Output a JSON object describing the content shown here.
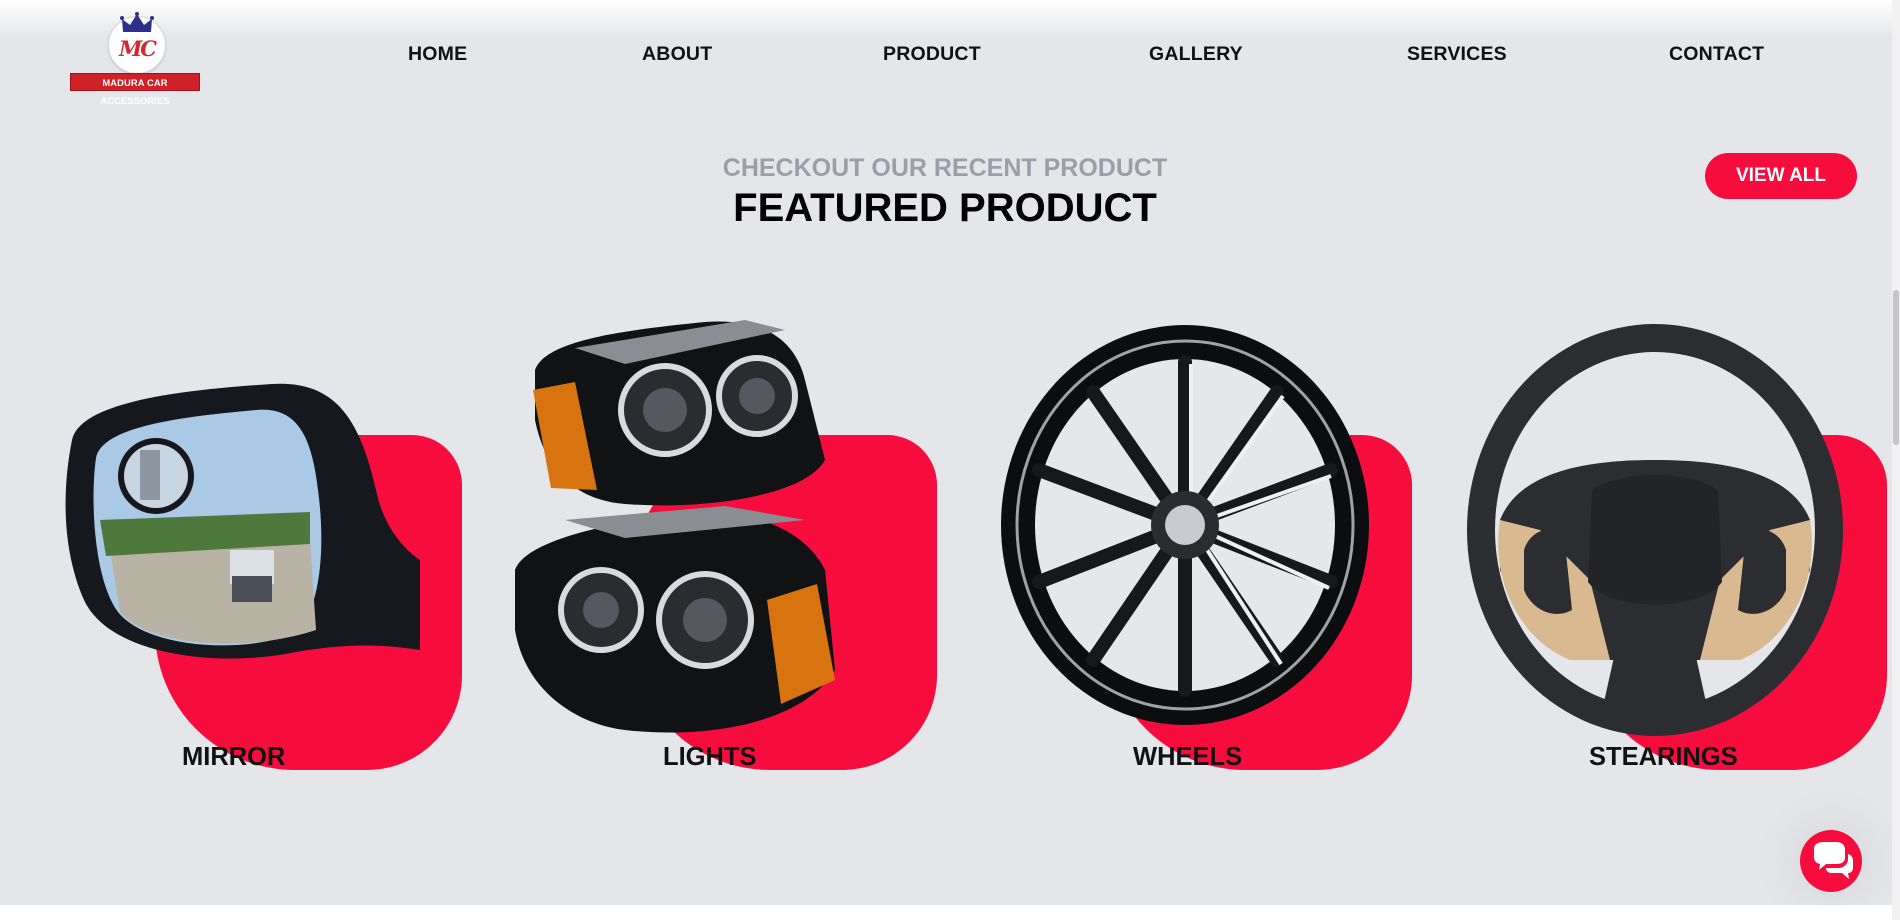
{
  "brand": {
    "monogram": "MC",
    "name": "MADURA CAR ACCESSORIES"
  },
  "nav": {
    "items": [
      {
        "label": "HOME"
      },
      {
        "label": "ABOUT"
      },
      {
        "label": "PRODUCT"
      },
      {
        "label": "GALLERY"
      },
      {
        "label": "SERVICES"
      },
      {
        "label": "CONTACT"
      }
    ]
  },
  "featured": {
    "subtitle": "CHECKOUT OUR RECENT PRODUCT",
    "title": "FEATURED PRODUCT",
    "view_all_label": "VIEW ALL",
    "products": [
      {
        "label": "MIRROR",
        "icon": "mirror-icon"
      },
      {
        "label": "LIGHTS",
        "icon": "headlight-icon"
      },
      {
        "label": "WHEELS",
        "icon": "wheel-icon"
      },
      {
        "label": "STEARINGS",
        "icon": "steering-wheel-icon"
      }
    ]
  },
  "chat": {
    "icon": "chat-bubbles-icon"
  },
  "colors": {
    "accent": "#f60d3d",
    "background": "#e5e6ea",
    "subtitle": "#9c9fa8",
    "text": "#111111"
  }
}
